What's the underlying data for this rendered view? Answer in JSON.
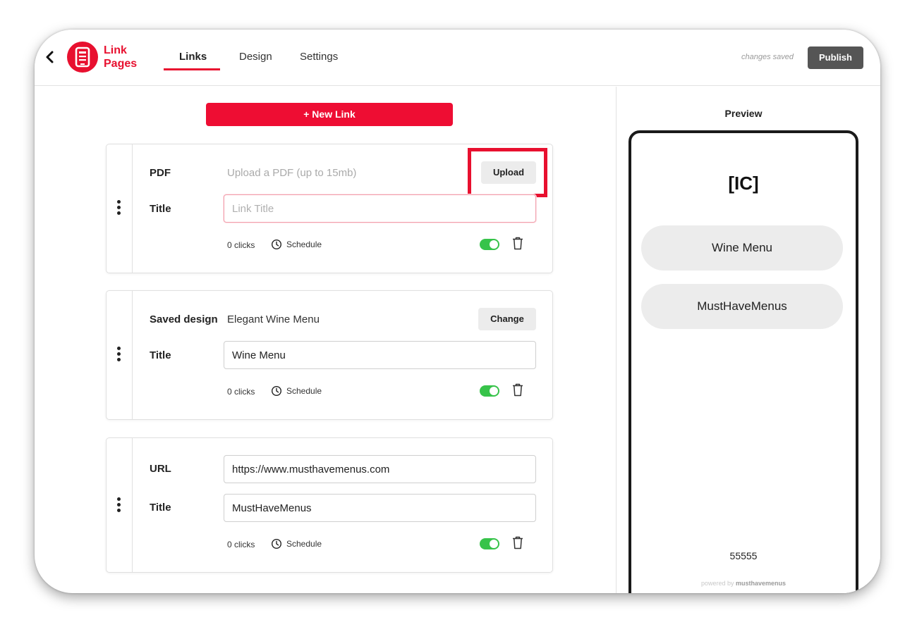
{
  "app": {
    "logo_line1": "Link",
    "logo_line2": "Pages",
    "accent_color": "#e8102f"
  },
  "header": {
    "tabs": [
      {
        "label": "Links",
        "active": true
      },
      {
        "label": "Design",
        "active": false
      },
      {
        "label": "Settings",
        "active": false
      }
    ],
    "save_status": "changes saved",
    "publish_label": "Publish"
  },
  "editor": {
    "new_link_label": "+ New Link",
    "cards": [
      {
        "type_label": "PDF",
        "type_value": "Upload a PDF (up to 15mb)",
        "action_label": "Upload",
        "title_label": "Title",
        "title_value": "",
        "title_placeholder": "Link Title",
        "clicks": "0 clicks",
        "schedule_label": "Schedule",
        "enabled": true
      },
      {
        "type_label": "Saved design",
        "type_value": "Elegant Wine Menu",
        "action_label": "Change",
        "title_label": "Title",
        "title_value": "Wine Menu",
        "clicks": "0 clicks",
        "schedule_label": "Schedule",
        "enabled": true
      },
      {
        "type_label": "URL",
        "url_value": "https://www.musthavemenus.com",
        "title_label": "Title",
        "title_value": "MustHaveMenus",
        "clicks": "0 clicks",
        "schedule_label": "Schedule",
        "enabled": true
      }
    ]
  },
  "preview": {
    "title": "Preview",
    "brand": "[IC]",
    "links": [
      "Wine Menu",
      "MustHaveMenus"
    ],
    "footer_number": "55555",
    "powered_prefix": "powered by",
    "powered_brand": "musthavemenus"
  }
}
